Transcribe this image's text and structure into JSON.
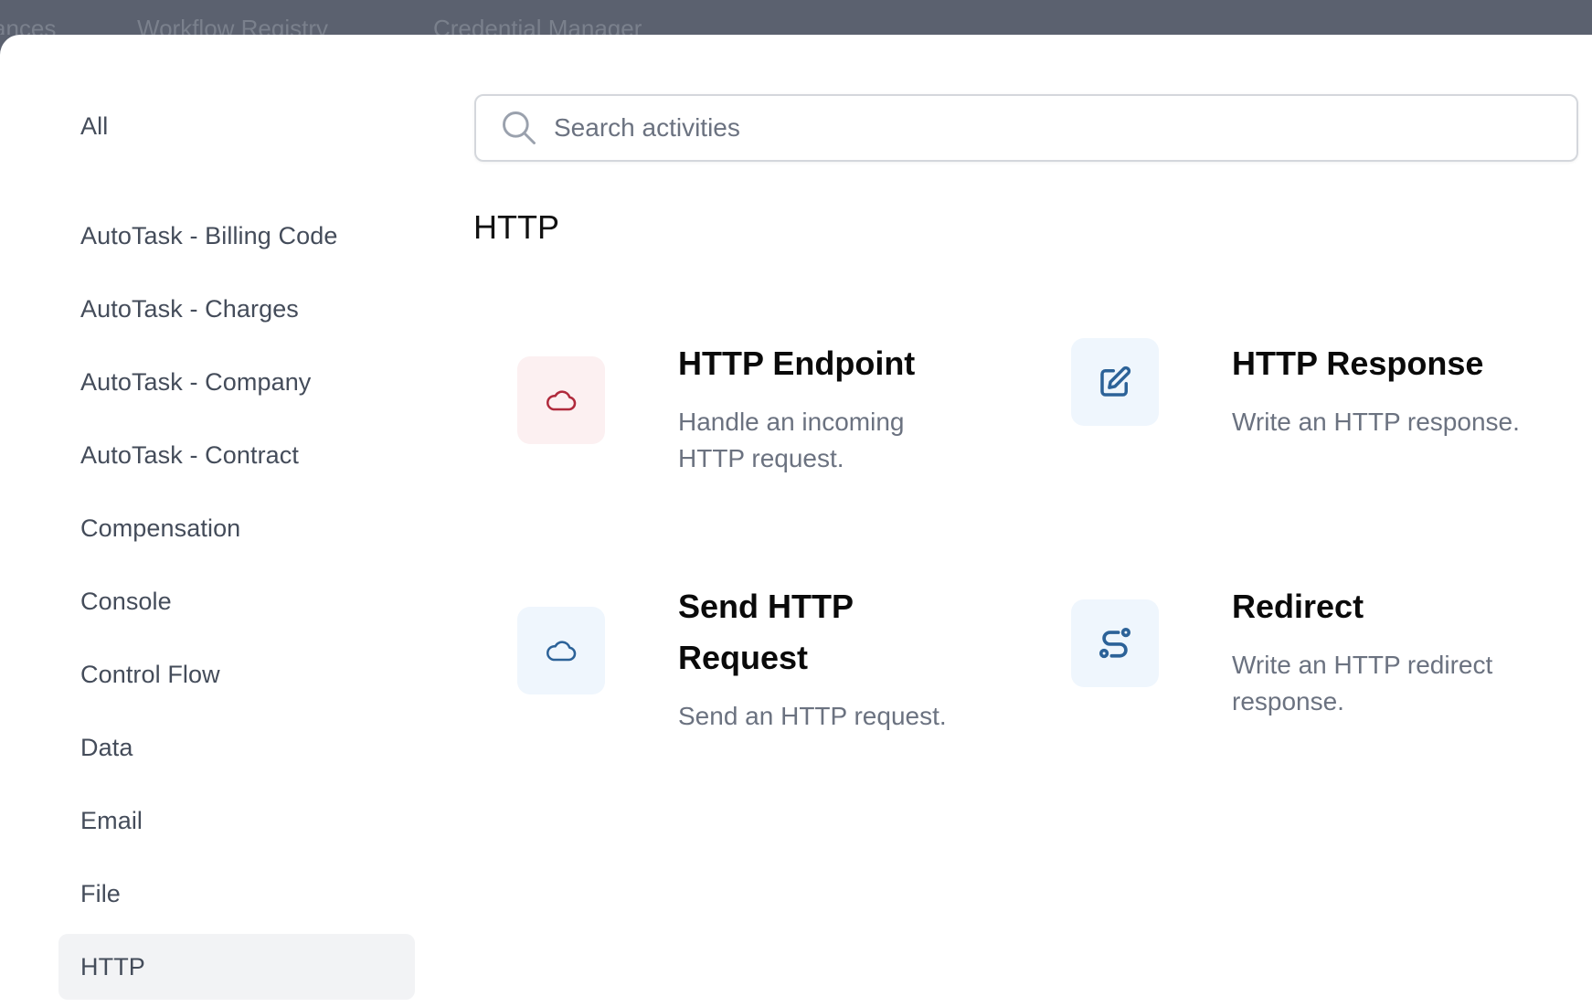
{
  "top_nav": {
    "tabs": [
      "ances",
      "Workflow Registry",
      "Credential Manager"
    ]
  },
  "sidebar": {
    "items": [
      {
        "label": "All",
        "active": false
      },
      {
        "label": "AutoTask - Billing Code",
        "active": false
      },
      {
        "label": "AutoTask - Charges",
        "active": false
      },
      {
        "label": "AutoTask - Company",
        "active": false
      },
      {
        "label": "AutoTask - Contract",
        "active": false
      },
      {
        "label": "Compensation",
        "active": false
      },
      {
        "label": "Console",
        "active": false
      },
      {
        "label": "Control Flow",
        "active": false
      },
      {
        "label": "Data",
        "active": false
      },
      {
        "label": "Email",
        "active": false
      },
      {
        "label": "File",
        "active": false
      },
      {
        "label": "HTTP",
        "active": true
      }
    ]
  },
  "search": {
    "placeholder": "Search activities",
    "value": "",
    "icon": "search-icon"
  },
  "section": {
    "title": "HTTP"
  },
  "activities": [
    {
      "title": "HTTP Endpoint",
      "description": "Handle an incoming HTTP request.",
      "icon": "cloud-icon",
      "icon_color": "#b02a3c",
      "icon_bg": "#fcf0f1"
    },
    {
      "title": "HTTP Response",
      "description": "Write an HTTP response.",
      "icon": "edit-icon",
      "icon_color": "#2c6298",
      "icon_bg": "#eff6fd"
    },
    {
      "title": "Send HTTP Request",
      "description": "Send an HTTP request.",
      "icon": "cloud-icon",
      "icon_color": "#2c6298",
      "icon_bg": "#eff6fd"
    },
    {
      "title": "Redirect",
      "description": "Write an HTTP redirect response.",
      "icon": "route-icon",
      "icon_color": "#2c6298",
      "icon_bg": "#eff6fd"
    }
  ]
}
